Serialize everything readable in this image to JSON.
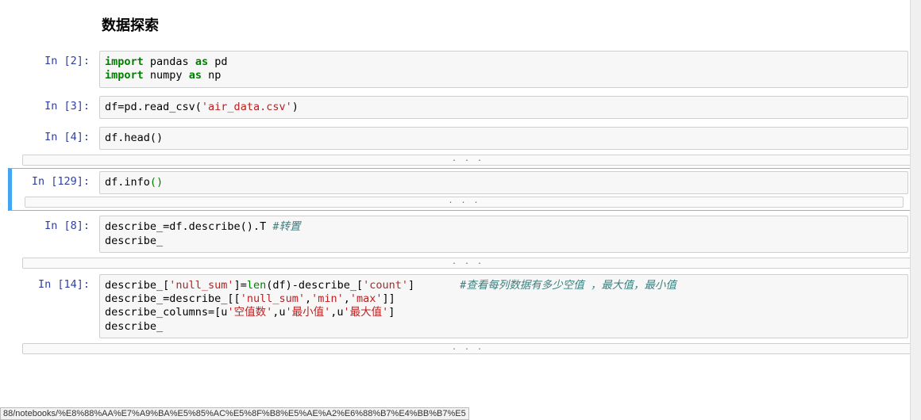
{
  "heading": "数据探索",
  "cells": {
    "c0": {
      "prompt": "In [2]:"
    },
    "c1": {
      "prompt": "In [3]:"
    },
    "c2": {
      "prompt": "In [4]:"
    },
    "c3": {
      "prompt": "In [129]:"
    },
    "c4": {
      "prompt": "In [8]:"
    },
    "c5": {
      "prompt": "In [14]:"
    }
  },
  "code": {
    "c0_kw1": "import",
    "c0_txt1": " pandas ",
    "c0_kw2": "as",
    "c0_txt2": " pd",
    "c0_kw3": "import",
    "c0_txt3": " numpy ",
    "c0_kw4": "as",
    "c0_txt4": " np",
    "c1_pre": "df=pd.read_csv(",
    "c1_str": "'air_data.csv'",
    "c1_post": ")",
    "c2": "df.head()",
    "c3_pre": "df.info",
    "c3_paren": "()",
    "c4_l1_pre": "describe_=df.describe().T ",
    "c4_l1_comment": "#转置",
    "c4_l2": "describe_",
    "c5_l1_a": "describe_[",
    "c5_l1_s1": "'null_sum'",
    "c5_l1_b": "]=",
    "c5_l1_len": "len",
    "c5_l1_c": "(df)-describe_[",
    "c5_l1_s2": "'count'",
    "c5_l1_d": "]       ",
    "c5_l1_comment": "#查看每列数据有多少空值 ，最大值，最小值",
    "c5_l2_a": "describe_=describe_[[",
    "c5_l2_s1": "'null_sum'",
    "c5_l2_b": ",",
    "c5_l2_s2": "'min'",
    "c5_l2_c": ",",
    "c5_l2_s3": "'max'",
    "c5_l2_d": "]]",
    "c5_l3_a": "describe_columns=[u",
    "c5_l3_s1": "'空值数'",
    "c5_l3_b": ",u",
    "c5_l3_s2": "'最小值'",
    "c5_l3_c": ",u",
    "c5_l3_s3": "'最大值'",
    "c5_l3_d": "]",
    "c5_l4": "describe_"
  },
  "collapsed": ". . .",
  "status": "88/notebooks/%E8%88%AA%E7%A9%BA%E5%85%AC%E5%8F%B8%E5%AE%A2%E6%88%B7%E4%BB%B7%E5"
}
